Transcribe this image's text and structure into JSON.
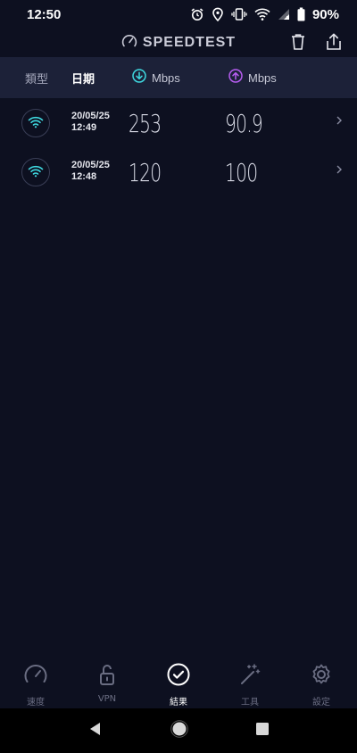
{
  "status_bar": {
    "time": "12:50",
    "battery_percent": "90%",
    "icons": [
      "alarm-icon",
      "location-icon",
      "vibrate-icon",
      "wifi-icon",
      "signal-icon",
      "battery-icon"
    ]
  },
  "header": {
    "title": "SPEEDTEST",
    "logo_icon": "speedometer-icon",
    "actions": [
      "trash-icon",
      "share-icon"
    ]
  },
  "columns": {
    "type_label": "類型",
    "date_label": "日期",
    "download_unit": "Mbps",
    "upload_unit": "Mbps",
    "download_icon": "download-arrow-icon",
    "upload_icon": "upload-arrow-icon"
  },
  "results": [
    {
      "type_icon": "wifi-icon",
      "date": "20/05/25",
      "time": "12:49",
      "download": "253",
      "upload": "90.9"
    },
    {
      "type_icon": "wifi-icon",
      "date": "20/05/25",
      "time": "12:48",
      "download": "120",
      "upload": "100"
    }
  ],
  "tabs": [
    {
      "label": "速度",
      "icon": "speedometer-icon",
      "active": false
    },
    {
      "label": "VPN",
      "icon": "unlock-icon",
      "active": false
    },
    {
      "label": "結果",
      "icon": "check-circle-icon",
      "active": true
    },
    {
      "label": "工具",
      "icon": "magic-wand-icon",
      "active": false
    },
    {
      "label": "設定",
      "icon": "gear-icon",
      "active": false
    }
  ],
  "nav_bar": [
    "back-icon",
    "home-icon",
    "recents-icon"
  ],
  "colors": {
    "background": "#0d1020",
    "header_bar": "#1c2138",
    "download_accent": "#3fd9e0",
    "upload_accent": "#b65df0",
    "wifi_accent": "#3fd9e0"
  }
}
